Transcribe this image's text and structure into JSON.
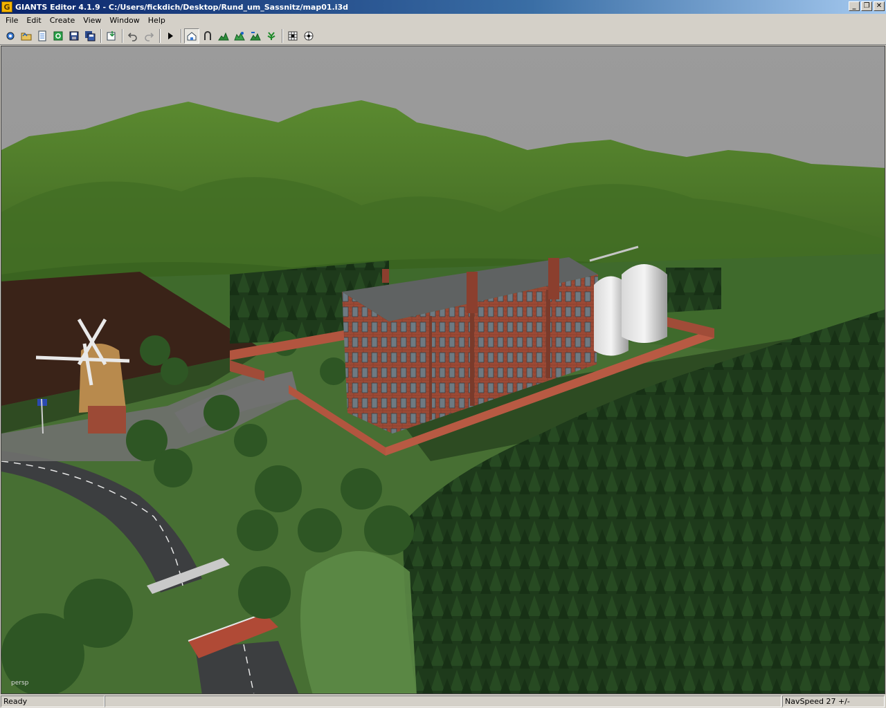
{
  "window": {
    "app_icon_letter": "G",
    "title": "GIANTS Editor 4.1.9 - C:/Users/fickdich/Desktop/Rund_um_Sassnitz/map01.i3d",
    "controls": {
      "minimize": "_",
      "restore": "❐",
      "close": "✕"
    }
  },
  "menu": {
    "items": [
      {
        "label": "File"
      },
      {
        "label": "Edit"
      },
      {
        "label": "Create"
      },
      {
        "label": "View"
      },
      {
        "label": "Window"
      },
      {
        "label": "Help"
      }
    ]
  },
  "toolbar": {
    "buttons": [
      {
        "icon": "new-scene-icon"
      },
      {
        "icon": "open-icon"
      },
      {
        "icon": "document-icon"
      },
      {
        "icon": "refresh-icon"
      },
      {
        "icon": "save-icon"
      },
      {
        "icon": "save-all-icon"
      },
      {
        "icon": "import-icon"
      },
      {
        "icon": "undo-icon"
      },
      {
        "icon": "redo-icon"
      },
      {
        "icon": "play-icon"
      },
      {
        "icon": "select-mode-icon",
        "pressed": true
      },
      {
        "icon": "move-mode-icon"
      },
      {
        "icon": "terrain-sculpt-icon"
      },
      {
        "icon": "terrain-paint-icon"
      },
      {
        "icon": "terrain-smooth-icon"
      },
      {
        "icon": "foliage-paint-icon"
      },
      {
        "icon": "snap-icon"
      },
      {
        "icon": "grid-icon"
      }
    ]
  },
  "viewport": {
    "camera_label": "persp",
    "colors": {
      "sky": "#9a9a9a",
      "hills": "#4f7a2a",
      "forest": "#1f3f1c",
      "brick": "#9c4a36",
      "roof": "#5f6262"
    }
  },
  "status": {
    "message": "Ready",
    "nav_speed": "NavSpeed 27 +/-"
  }
}
